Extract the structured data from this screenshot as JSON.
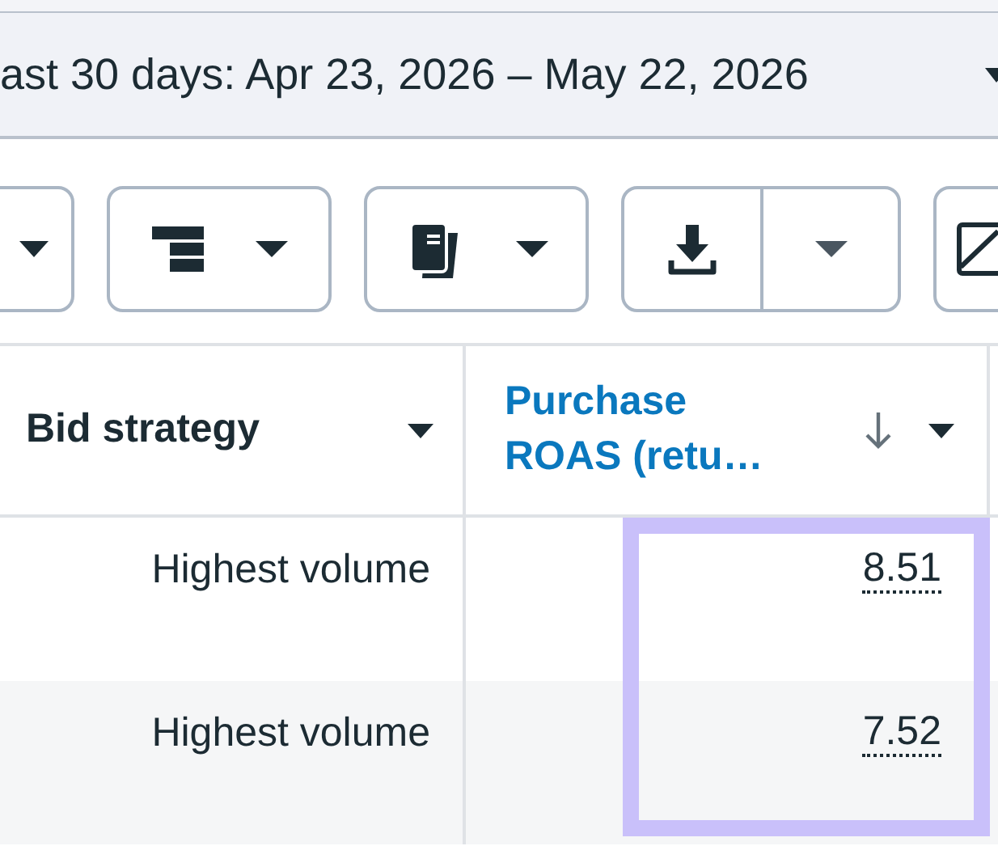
{
  "date_range": {
    "label": "ast 30 days: Apr 23, 2026 – May 22, 2026"
  },
  "toolbar": [
    {
      "kind": "caret"
    },
    {
      "kind": "breakdown"
    },
    {
      "kind": "reports"
    },
    {
      "kind": "export"
    },
    {
      "kind": "chart"
    }
  ],
  "table": {
    "columns": [
      {
        "label": "Bid strategy",
        "sorted_descending": false,
        "link": false
      },
      {
        "label": "Purchase ROAS (retu…",
        "sorted_descending": true,
        "link": true
      }
    ],
    "rows": [
      {
        "bid_strategy": "Highest volume",
        "roas": "8.51"
      },
      {
        "bid_strategy": "Highest volume",
        "roas": "7.52"
      }
    ],
    "roas_highlighted": true
  }
}
